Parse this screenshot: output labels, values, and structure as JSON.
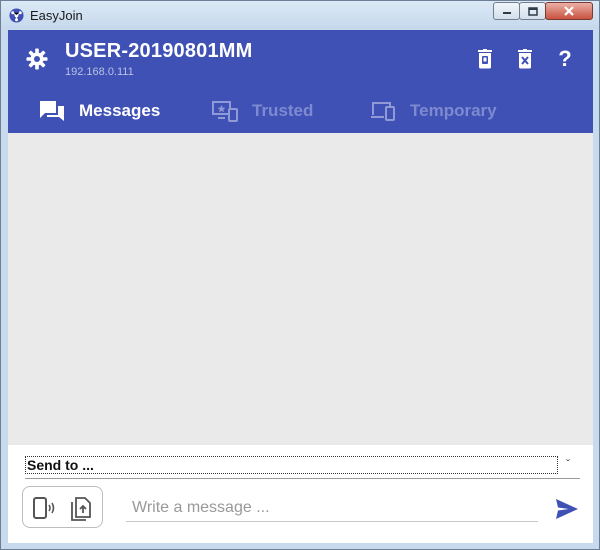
{
  "window": {
    "title": "EasyJoin",
    "app_icon": "easyjoin-logo-icon",
    "controls": [
      "minimize-icon",
      "maximize-icon",
      "close-icon"
    ]
  },
  "header": {
    "settings_icon": "gear-icon",
    "device_name": "USER-20190801MM",
    "device_ip": "192.168.0.111",
    "actions": [
      {
        "icon": "delete-device-icon"
      },
      {
        "icon": "clear-delete-icon"
      },
      {
        "icon": "help-icon",
        "label": "?"
      }
    ],
    "accent_color": "#3f51b5"
  },
  "tabs": [
    {
      "label": "Messages",
      "icon": "messages-icon",
      "active": true
    },
    {
      "label": "Trusted",
      "icon": "trusted-devices-icon",
      "active": false
    },
    {
      "label": "Temporary",
      "icon": "temporary-devices-icon",
      "active": false
    }
  ],
  "compose": {
    "send_to_label": "Send to ...",
    "dropdown_icon": "chevron-down-icon",
    "attach_icons": [
      "phone-share-icon",
      "file-upload-icon"
    ],
    "message_placeholder": "Write a message ...",
    "send_icon": "send-icon",
    "send_color": "#3f51b5"
  }
}
